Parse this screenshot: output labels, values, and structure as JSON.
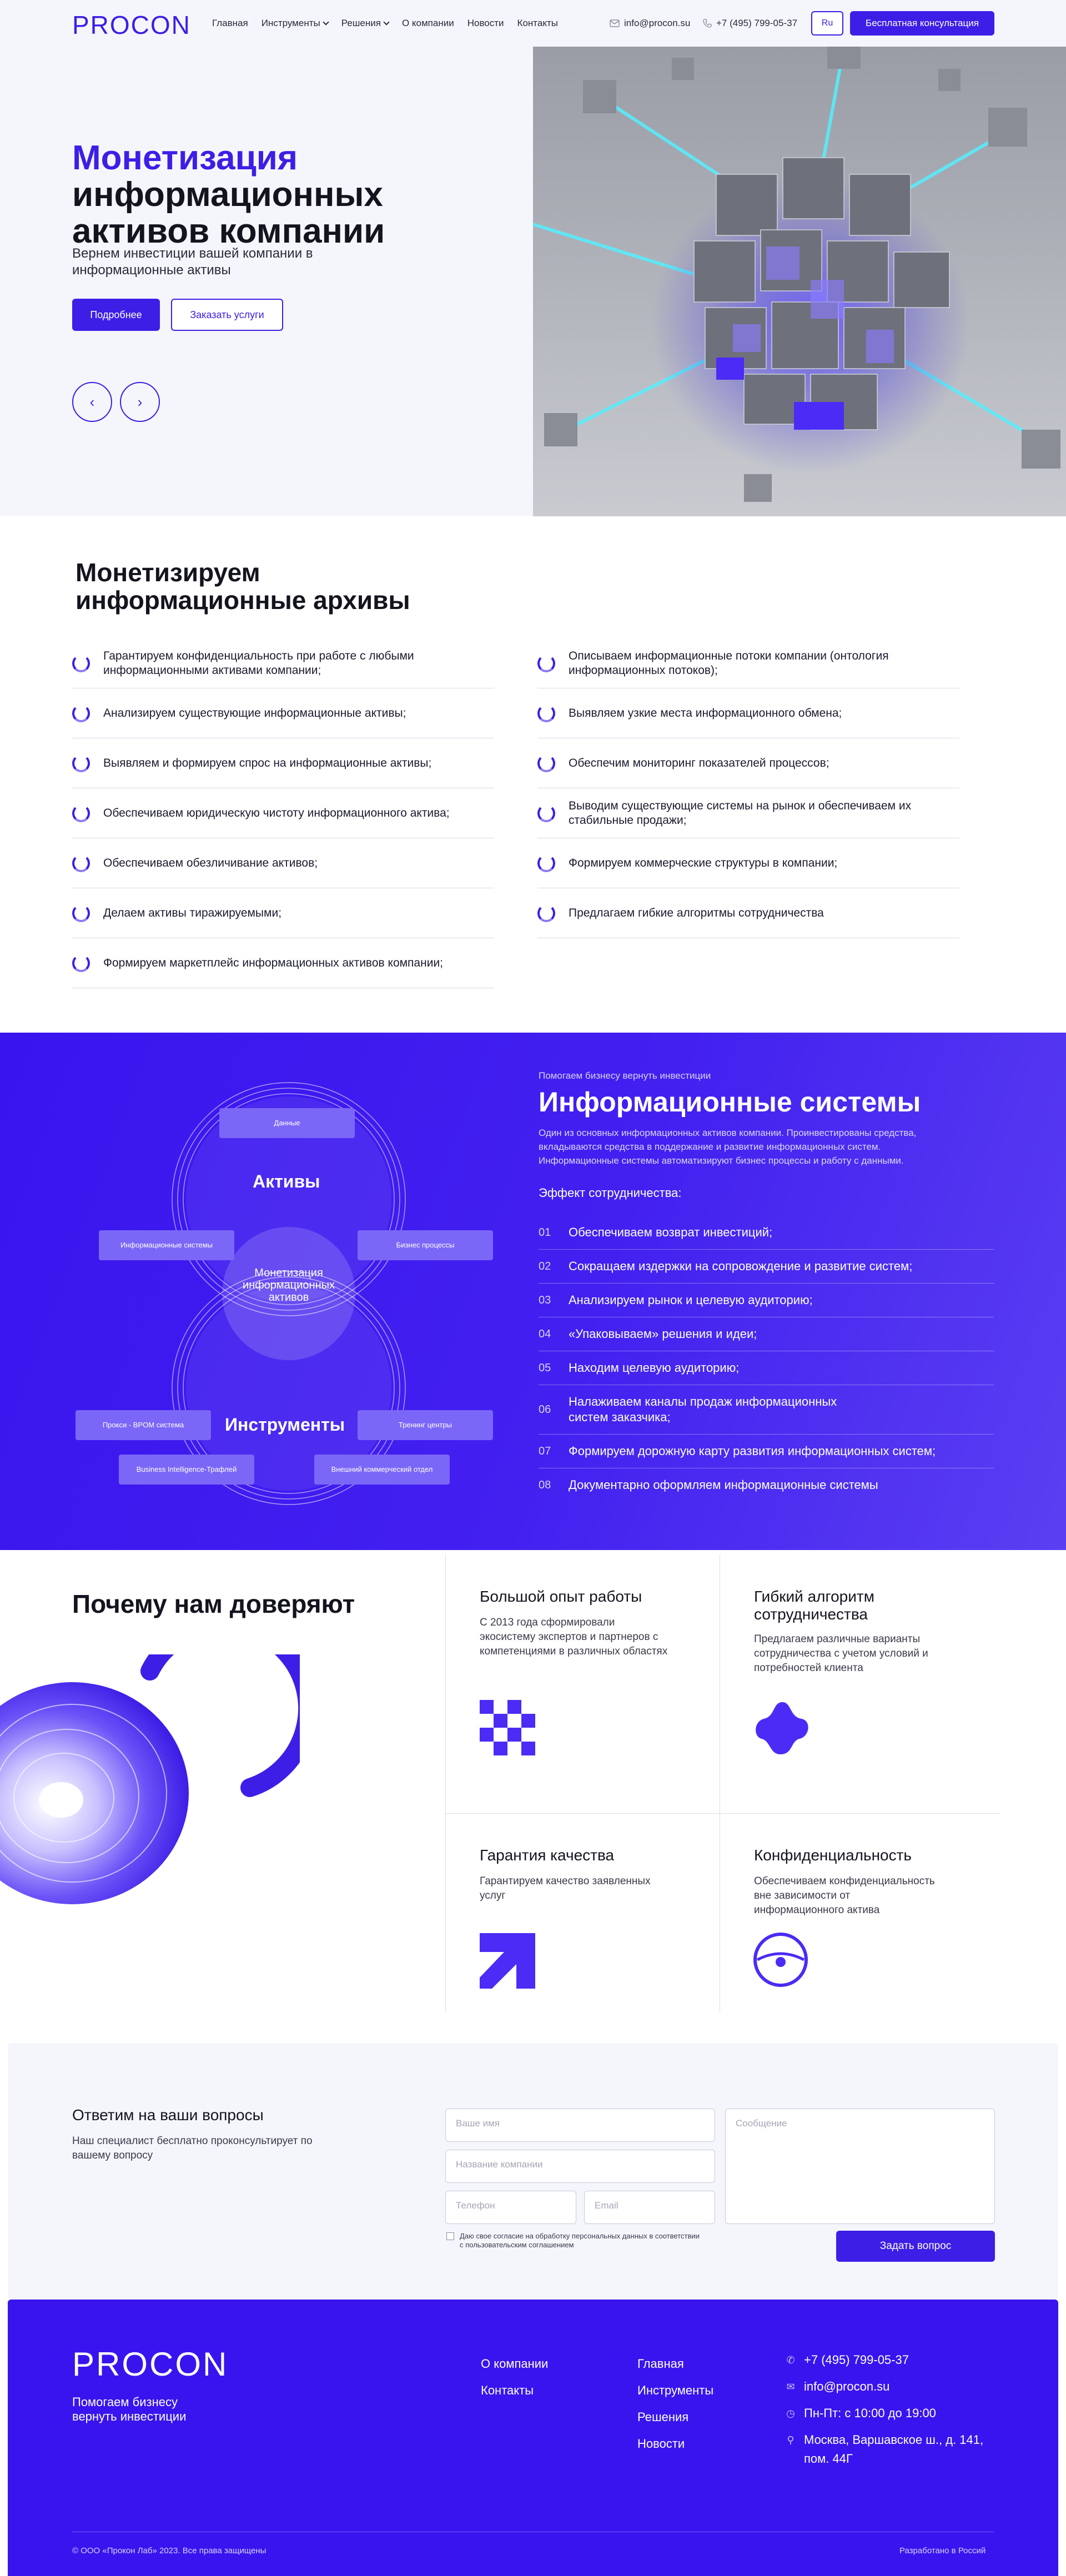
{
  "header": {
    "logo": "PROCON",
    "nav": [
      {
        "label": "Главная",
        "dropdown": false
      },
      {
        "label": "Инструменты",
        "dropdown": true
      },
      {
        "label": "Решения",
        "dropdown": true
      },
      {
        "label": "О компании",
        "dropdown": false
      },
      {
        "label": "Новости",
        "dropdown": false
      },
      {
        "label": "Контакты",
        "dropdown": false
      }
    ],
    "email": "info@procon.su",
    "phone": "+7 (495) 799-05-37",
    "lang": "Ru",
    "cta": "Бесплатная консультация"
  },
  "hero": {
    "title_accent": "Монетизация",
    "title_rest": "информационных активов компании",
    "subtitle": "Вернем инвестиции вашей компании в информационные активы",
    "btn_more": "Подробнее",
    "btn_order": "Заказать услуги",
    "prev_icon": "‹",
    "next_icon": "›"
  },
  "archives": {
    "title": "Монетизируем информационные архивы",
    "left": [
      "Гарантируем конфиденциальность при работе с любыми информационными активами компании;",
      "Анализируем существующие информационные активы;",
      "Выявляем и формируем спрос на информационные активы;",
      "Обеспечиваем юридическую чистоту информационного актива;",
      "Обеспечиваем обезличивание активов;",
      "Делаем активы тиражируемыми;",
      "Формируем маркетплейс информационных активов компании;"
    ],
    "right": [
      "Описываем информационные потоки компании (онтология информационных потоков);",
      "Выявляем узкие места информационного обмена;",
      "Обеспечим мониторинг показателей процессов;",
      "Выводим существующие системы на рынок и обеспечиваем их стабильные продажи;",
      "Формируем коммерческие структуры в компании;",
      "Предлагаем гибкие алгоритмы сотрудничества"
    ]
  },
  "info": {
    "kicker": "Помогаем бизнесу вернуть инвестиции",
    "title": "Информационные системы",
    "description": "Один из основных информационных активов компании. Проинвестированы средства, вкладываются средства в поддержание и развитие информационных систем. Информационные системы автоматизируют бизнес процессы и работу с данными.",
    "effect": "Эффект сотрудничества:",
    "items": [
      {
        "num": "01",
        "text": "Обеспечиваем возврат инвестиций;"
      },
      {
        "num": "02",
        "text": "Сокращаем издержки на сопровождение и развитие систем;"
      },
      {
        "num": "03",
        "text": "Анализируем рынок и целевую аудиторию;"
      },
      {
        "num": "04",
        "text": "«Упаковываем» решения и идеи;"
      },
      {
        "num": "05",
        "text": "Находим целевую аудиторию;"
      },
      {
        "num": "06",
        "text": "Налаживаем каналы продаж информационных систем заказчика;"
      },
      {
        "num": "07",
        "text": "Формируем дорожную карту развития информационных систем;"
      },
      {
        "num": "08",
        "text": "Документарно оформляем информационные системы"
      }
    ],
    "diagram": {
      "assets": "Активы",
      "tools": "Инструменты",
      "center": "Монетизация информационных активов",
      "data": "Данные",
      "infosystems": "Информационные системы",
      "processes": "Бизнес процессы",
      "proxy": "Прокси - BPOM система",
      "trainings": "Тренинг центры",
      "bi": "Business Intelligence-Трафлей",
      "external": "Внешний коммерческий отдел"
    }
  },
  "trust": {
    "title": "Почему нам доверяют",
    "cells": [
      {
        "title": "Большой опыт работы",
        "text": "С 2013 года сформировали экосистему экспертов и партнеров с компетенциями в различных областях",
        "icon": "checker-icon"
      },
      {
        "title": "Гибкий алгоритм сотрудничества",
        "text": "Предлагаем различные варианты сотрудничества с учетом условий и потребностей клиента",
        "icon": "blob-icon"
      },
      {
        "title": "Гарантия качества",
        "text": "Гарантируем качество заявленных услуг",
        "icon": "arrow-up-right-icon"
      },
      {
        "title": "Конфиденциальность",
        "text": "Обеспечиваем конфиденциальность вне зависимости от информационного актива",
        "icon": "eye-icon"
      }
    ]
  },
  "form": {
    "title": "Ответим на ваши вопросы",
    "subtitle": "Наш специалист бесплатно проконсультирует по вашему вопросу",
    "name_placeholder": "Ваше имя",
    "company_placeholder": "Название компании",
    "phone_placeholder": "Телефон",
    "email_placeholder": "Email",
    "message_placeholder": "Сообщение",
    "agree": "Даю свое согласие на обработку персональных данных в соответствии с пользовательским соглашением",
    "submit": "Задать вопрос"
  },
  "footer": {
    "logo": "PROCON",
    "tagline": "Помогаем бизнесу вернуть инвестиции",
    "col1": [
      "О компании",
      "Контакты"
    ],
    "col2": [
      "Главная",
      "Инструменты",
      "Решения",
      "Новости"
    ],
    "phone": "+7 (495) 799-05-37",
    "email": "info@procon.su",
    "hours": "Пн-Пт: с 10:00 до 19:00",
    "address": "Москва, Варшавское ш., д. 141, пом. 44Г",
    "copyright": "© ООО «Прокон Лаб» 2023. Все права защищены",
    "developer": "Разработано в Россий"
  },
  "colors": {
    "accent": "#3d1ee6",
    "accent_bg": "#3a14ee",
    "light_bg": "#f4f6fc"
  }
}
